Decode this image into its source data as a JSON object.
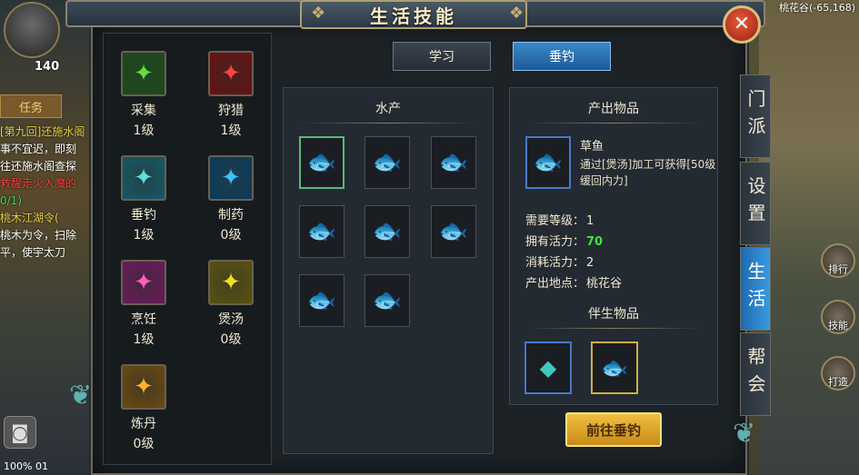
{
  "hud": {
    "level": "140",
    "quest_tab": "任务",
    "quest_lines": [
      {
        "text": "[第九回]还施水阁",
        "cls": "y"
      },
      {
        "text": "事不宜迟，即刻",
        "cls": ""
      },
      {
        "text": "往还施水阁查探",
        "cls": ""
      },
      {
        "text": "救醒走火入魔的",
        "cls": "r"
      },
      {
        "text": "0/1)",
        "cls": "g"
      },
      {
        "text": "桃木江湖令(",
        "cls": "y"
      },
      {
        "text": "桃木为令，扫除",
        "cls": ""
      },
      {
        "text": "平，使宇太刀",
        "cls": ""
      }
    ],
    "coord": "桃花谷(-65,168)",
    "right_icons": [
      "排行",
      "技能",
      "打造"
    ],
    "bottom_status": "100%    01"
  },
  "title": "生活技能",
  "close_icon": "✕",
  "skills": [
    {
      "name": "采集",
      "level": "1级",
      "icon": "gather-icon",
      "bg": "#1a4a1a",
      "color": "#60e040"
    },
    {
      "name": "狩猎",
      "level": "1级",
      "icon": "hunt-icon",
      "bg": "#6a1010",
      "color": "#ff4040"
    },
    {
      "name": "垂钓",
      "level": "1级",
      "icon": "fishing-icon",
      "bg": "#105a6a",
      "color": "#60e0e0"
    },
    {
      "name": "制药",
      "level": "0级",
      "icon": "medicine-icon",
      "bg": "#0a3a5a",
      "color": "#40c0ff"
    },
    {
      "name": "烹饪",
      "level": "1级",
      "icon": "cooking-icon",
      "bg": "#6a1a5a",
      "color": "#ff60c0"
    },
    {
      "name": "煲汤",
      "level": "0级",
      "icon": "soup-icon",
      "bg": "#5a5010",
      "color": "#f0e020"
    },
    {
      "name": "炼丹",
      "level": "0级",
      "icon": "alchemy-icon",
      "bg": "#6a4a10",
      "color": "#ffb030"
    }
  ],
  "tabs": {
    "learn": "学习",
    "fishing": "垂钓"
  },
  "aquatic": {
    "title": "水产"
  },
  "output": {
    "title": "产出物品",
    "name": "草鱼",
    "desc": "通过[煲汤]加工可获得[50级缓回内力]",
    "stats": [
      {
        "label": "需要等级：",
        "value": "1",
        "green": false
      },
      {
        "label": "拥有活力：",
        "value": "70",
        "green": true
      },
      {
        "label": "消耗活力：",
        "value": "2",
        "green": false
      },
      {
        "label": "产出地点：",
        "value": "桃花谷",
        "green": false
      }
    ],
    "byproduct_title": "伴生物品",
    "go_button": "前往垂钓"
  },
  "side_tabs": [
    {
      "label": "门派",
      "active": false
    },
    {
      "label": "设置",
      "active": false
    },
    {
      "label": "生活",
      "active": true
    },
    {
      "label": "帮会",
      "active": false
    }
  ],
  "colors": {
    "accent_blue": "#3a88c8",
    "gold_button": "#f0c040",
    "active_green": "#40e040"
  }
}
